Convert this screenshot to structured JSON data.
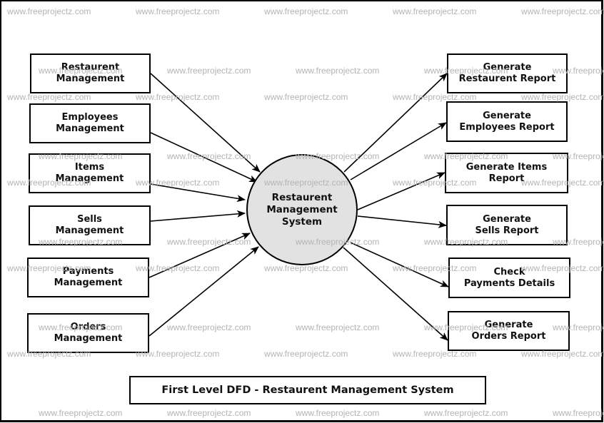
{
  "diagram": {
    "title": "First Level DFD - Restaurent Management System",
    "process": {
      "lines": [
        "Restaurent",
        "Management",
        "System"
      ],
      "fill": "#e2e2e2"
    },
    "inputs": [
      {
        "id": "restaurent-management",
        "lines": [
          "Restaurent",
          "Management"
        ]
      },
      {
        "id": "employees-management",
        "lines": [
          "Employees",
          "Management"
        ]
      },
      {
        "id": "items-management",
        "lines": [
          "Items",
          "Management"
        ]
      },
      {
        "id": "sells-management",
        "lines": [
          "Sells",
          "Management"
        ]
      },
      {
        "id": "payments-management",
        "lines": [
          "Payments",
          "Management"
        ]
      },
      {
        "id": "orders-management",
        "lines": [
          "Orders",
          "Management"
        ]
      }
    ],
    "outputs": [
      {
        "id": "generate-restaurent-report",
        "lines": [
          "Generate",
          "Restaurent Report"
        ]
      },
      {
        "id": "generate-employees-report",
        "lines": [
          "Generate",
          "Employees Report"
        ]
      },
      {
        "id": "generate-items-report",
        "lines": [
          "Generate Items",
          "Report"
        ]
      },
      {
        "id": "generate-sells-report",
        "lines": [
          "Generate",
          "Sells Report"
        ]
      },
      {
        "id": "check-payments-details",
        "lines": [
          "Check",
          "Payments Details"
        ]
      },
      {
        "id": "generate-orders-report",
        "lines": [
          "Generate",
          "Orders Report"
        ]
      }
    ],
    "flows": [
      {
        "from": "restaurent-management",
        "to": "process"
      },
      {
        "from": "employees-management",
        "to": "process"
      },
      {
        "from": "items-management",
        "to": "process"
      },
      {
        "from": "sells-management",
        "to": "process"
      },
      {
        "from": "payments-management",
        "to": "process"
      },
      {
        "from": "orders-management",
        "to": "process"
      },
      {
        "from": "process",
        "to": "generate-restaurent-report"
      },
      {
        "from": "process",
        "to": "generate-employees-report"
      },
      {
        "from": "process",
        "to": "generate-items-report"
      },
      {
        "from": "process",
        "to": "generate-sells-report"
      },
      {
        "from": "process",
        "to": "check-payments-details"
      },
      {
        "from": "process",
        "to": "generate-orders-report"
      }
    ]
  },
  "watermark": "www.freeprojectz.com"
}
